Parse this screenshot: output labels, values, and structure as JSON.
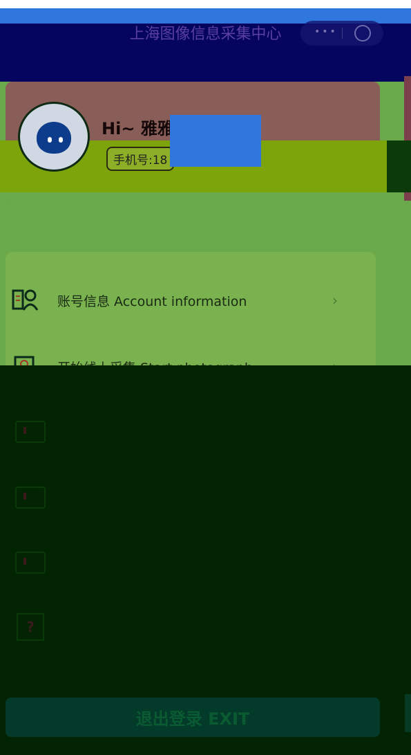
{
  "header": {
    "title": "上海图像信息采集中心",
    "capsule": {
      "more_icon": "more-dots-icon",
      "close_icon": "record-ring-icon"
    }
  },
  "profile": {
    "greeting": "Hi~ 雅雅",
    "phone": "手机号:18",
    "avatar_icon": "cartoon-avatar"
  },
  "menu": {
    "items": [
      {
        "label": "账号信息 Account information",
        "icon": "account-icon"
      },
      {
        "label": "开始线上采集 Start photograph",
        "icon": "photograph-icon"
      }
    ]
  },
  "exit_button": {
    "label": "退出登录 EXIT"
  },
  "colors": {
    "nav": "#05055f",
    "card": "#79b24f",
    "overlay": "#022402"
  }
}
